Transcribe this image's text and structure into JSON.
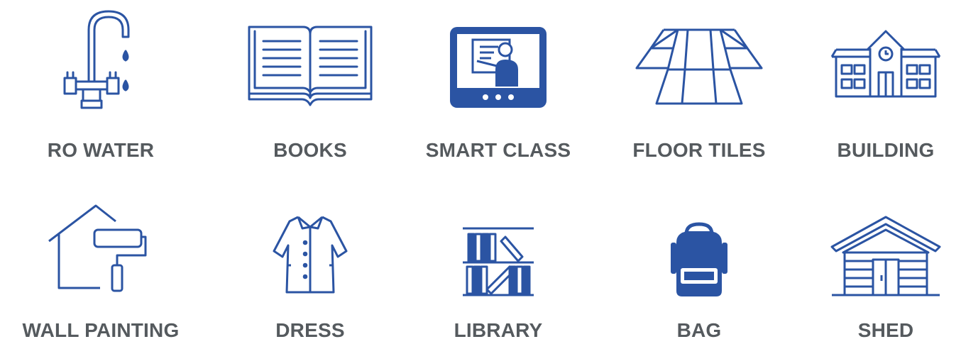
{
  "colors": {
    "icon": "#2b54a3",
    "label": "#555a5e"
  },
  "items": [
    {
      "label": "RO WATER",
      "icon": "faucet-icon"
    },
    {
      "label": "BOOKS",
      "icon": "open-book-icon"
    },
    {
      "label": "SMART CLASS",
      "icon": "smart-class-screen-icon"
    },
    {
      "label": "FLOOR TILES",
      "icon": "floor-tiles-icon"
    },
    {
      "label": "BUILDING",
      "icon": "school-building-icon"
    },
    {
      "label": "WALL PAINTING",
      "icon": "paint-roller-house-icon"
    },
    {
      "label": "DRESS",
      "icon": "dress-icon"
    },
    {
      "label": "LIBRARY",
      "icon": "bookshelf-icon"
    },
    {
      "label": "BAG",
      "icon": "backpack-icon"
    },
    {
      "label": "SHED",
      "icon": "shed-icon"
    }
  ]
}
